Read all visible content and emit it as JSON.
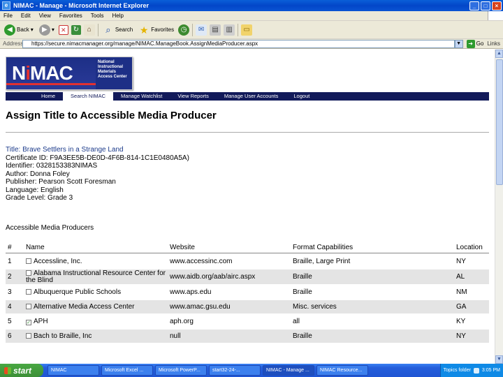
{
  "window": {
    "title": "NIMAC - Manage - Microsoft Internet Explorer",
    "buttons": [
      "_",
      "□",
      "×"
    ]
  },
  "menu": [
    "File",
    "Edit",
    "View",
    "Favorites",
    "Tools",
    "Help"
  ],
  "toolbar": {
    "back": "Back",
    "search": "Search",
    "favorites": "Favorites"
  },
  "address": {
    "label": "Address",
    "url": "https://secure.nimacmanager.org/manage/NIMAC.ManageBook.AssignMediaProducer.aspx",
    "go": "Go",
    "links": "Links"
  },
  "logo": {
    "mark_a": "N",
    "mark_i": "i",
    "mark_b": "MAC",
    "text": "National Instructional Materials Access Center"
  },
  "nav": [
    "Home",
    "Search NIMAC",
    "Manage Watchlist",
    "View Reports",
    "Manage User Accounts",
    "Logout"
  ],
  "page": {
    "title": "Assign Title to Accessible Media Producer",
    "details": {
      "title_line": "Title: Brave Settlers in a Strange Land",
      "certificate": "Certificate ID: F9A3EE5B-DE0D-4F6B-814-1C1E0480A5A)",
      "identifier": "Identifier: 0328153383NIMAS",
      "author": "Author: Donna Foley",
      "publisher": "Publisher: Pearson Scott Foresman",
      "language": "Language: English",
      "grade": "Grade Level: Grade 3"
    },
    "section": "Accessible Media Producers"
  },
  "table": {
    "headers": [
      "#",
      "Name",
      "Website",
      "Format Capabilities",
      "Location"
    ],
    "rows": [
      {
        "num": "1",
        "name": "Accessline, Inc.",
        "website": "www.accessinc.com",
        "formats": "Braille, Large Print",
        "location": "NY",
        "checked": false
      },
      {
        "num": "2",
        "name": "Alabama Instructional Resource Center for the Blind",
        "website": "www.aidb.org/aab/airc.aspx",
        "formats": "Braille",
        "location": "AL",
        "checked": false
      },
      {
        "num": "3",
        "name": "Albuquerque Public Schools",
        "website": "www.aps.edu",
        "formats": "Braille",
        "location": "NM",
        "checked": false
      },
      {
        "num": "4",
        "name": "Alternative Media Access Center",
        "website": "www.amac.gsu.edu",
        "formats": "Misc. services",
        "location": "GA",
        "checked": false
      },
      {
        "num": "5",
        "name": "APH",
        "website": "aph.org",
        "formats": "all",
        "location": "KY",
        "checked": true
      },
      {
        "num": "6",
        "name": "Bach to Braille, Inc",
        "website": "null",
        "formats": "Braille",
        "location": "NY",
        "checked": false
      }
    ]
  },
  "taskbar": {
    "start": "start",
    "tasks": [
      "NIMAC",
      "Microsoft Excel ...",
      "Microsoft PowerP...",
      "start32-24-...",
      "NIMAC - Manage ...",
      "NIMAC Resource..."
    ],
    "tray_text": "Topics folder",
    "clock": "3:05 PM"
  }
}
